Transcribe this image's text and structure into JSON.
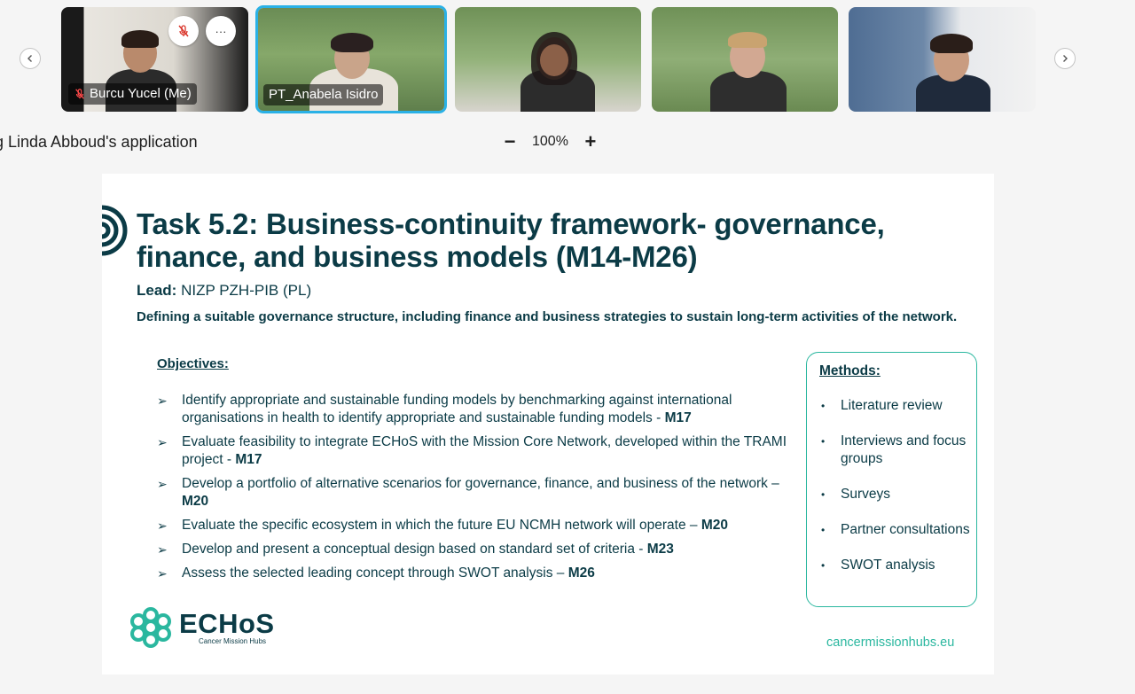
{
  "participants": [
    {
      "name": "Burcu Yucel (Me)",
      "muted": true,
      "active": false
    },
    {
      "name": "PT_Anabela Isidro",
      "muted": false,
      "active": true
    },
    {
      "name": "",
      "muted": false,
      "active": false
    },
    {
      "name": "",
      "muted": false,
      "active": false
    },
    {
      "name": "",
      "muted": false,
      "active": false
    }
  ],
  "tile_controls": {
    "more_label": "···"
  },
  "share": {
    "title": "g Linda Abboud's application",
    "zoom_minus": "−",
    "zoom_level": "100%",
    "zoom_plus": "+"
  },
  "slide": {
    "title": "Task 5.2: Business-continuity framework- governance, finance, and business models (M14-M26)",
    "lead_label": "Lead:",
    "lead_value": " NIZP PZH-PIB (PL)",
    "purpose": "Defining a suitable governance structure, including finance and business strategies to sustain long-term activities of the network.",
    "objectives_heading": "Objectives:",
    "objectives": [
      {
        "text": "Identify appropriate and sustainable funding models by benchmarking against international organisations in health to identify appropriate and sustainable funding models - ",
        "milestone": "M17"
      },
      {
        "text": "Evaluate feasibility to integrate ECHoS with the Mission Core Network, developed within the TRAMI project - ",
        "milestone": "M17"
      },
      {
        "text": "Develop a portfolio of alternative scenarios for governance, finance, and business of the network – ",
        "milestone": "M20"
      },
      {
        "text": "Evaluate the specific ecosystem in which the future EU NCMH network will operate – ",
        "milestone": "M20"
      },
      {
        "text": "Develop and present a conceptual design based on standard set of criteria  - ",
        "milestone": "M23"
      },
      {
        "text": "Assess the selected leading concept through SWOT analysis – ",
        "milestone": "M26"
      }
    ],
    "methods_heading": "Methods:",
    "methods": [
      "Literature review",
      "Interviews and focus groups",
      "Surveys",
      "Partner consultations",
      "SWOT analysis"
    ],
    "logo_name": "ECHoS",
    "logo_tagline": "Cancer Mission Hubs",
    "url": "cancermissionhubs.eu"
  },
  "colors": {
    "brand_teal": "#2ab79f",
    "title_navy": "#0b3b46",
    "active_border": "#2ab1e6"
  }
}
